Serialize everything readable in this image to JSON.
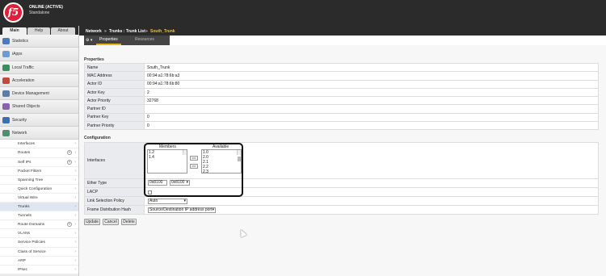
{
  "header": {
    "logo": "f5",
    "status_line1": "ONLINE (ACTIVE)",
    "status_line2": "Standalone"
  },
  "nav": {
    "tabs": [
      "Main",
      "Help",
      "About"
    ],
    "sections": [
      {
        "label": "Statistics",
        "icon": "chart-icon",
        "color": "#4a7bbf"
      },
      {
        "label": "iApps",
        "icon": "iapps-icon",
        "color": "#6a9bd3"
      },
      {
        "label": "Local Traffic",
        "icon": "traffic-icon",
        "color": "#3a8f5a"
      },
      {
        "label": "Acceleration",
        "icon": "acceleration-icon",
        "color": "#c24a3a"
      },
      {
        "label": "Device Management",
        "icon": "device-icon",
        "color": "#5b7da8"
      },
      {
        "label": "Shared Objects",
        "icon": "shared-objects-icon",
        "color": "#8a5fb0"
      },
      {
        "label": "Security",
        "icon": "security-icon",
        "color": "#3b6fb0"
      },
      {
        "label": "Network",
        "icon": "network-icon",
        "color": "#4f8f6f"
      }
    ],
    "network_items": [
      {
        "label": "Interfaces",
        "plus": false
      },
      {
        "label": "Routes",
        "plus": true
      },
      {
        "label": "Self IPs",
        "plus": true
      },
      {
        "label": "Packet Filters",
        "plus": false
      },
      {
        "label": "Spanning Tree",
        "plus": false
      },
      {
        "label": "Quick Configuration",
        "plus": false
      },
      {
        "label": "Virtual Wire",
        "plus": false
      },
      {
        "label": "Trunks",
        "plus": false
      },
      {
        "label": "Tunnels",
        "plus": false
      },
      {
        "label": "Route Domains",
        "plus": true
      },
      {
        "label": "VLANs",
        "plus": false
      },
      {
        "label": "Service Policies",
        "plus": false
      },
      {
        "label": "Class of Service",
        "plus": false
      },
      {
        "label": "ARP",
        "plus": false
      },
      {
        "label": "IPsec",
        "plus": false
      }
    ]
  },
  "breadcrumb": {
    "part1": "Network",
    "sep": "»",
    "part2": "Trunks : Trunk List",
    "part3": "South_Trunk"
  },
  "tabs": {
    "properties": "Properties",
    "resources": "Resources"
  },
  "properties": {
    "title": "Properties",
    "rows": [
      {
        "key": "Name",
        "value": "South_Trunk"
      },
      {
        "key": "MAC Address",
        "value": "00:94:a1:78:6b:a3"
      },
      {
        "key": "Actor ID",
        "value": "00:94:a1:78:6b:80"
      },
      {
        "key": "Actor Key",
        "value": "2"
      },
      {
        "key": "Actor Priority",
        "value": "32768"
      },
      {
        "key": "Partner ID",
        "value": ""
      },
      {
        "key": "Partner Key",
        "value": "0"
      },
      {
        "key": "Partner Priority",
        "value": "0"
      }
    ]
  },
  "configuration": {
    "title": "Configuration",
    "interfaces_label": "Interfaces",
    "members_label": "Members",
    "available_label": "Available",
    "members": [
      "1.2",
      "1.4"
    ],
    "available": [
      "1.0",
      "2.0",
      "2.1",
      "2.2",
      "2.3"
    ],
    "move_left": "<<",
    "move_right": ">>",
    "ether_type_label": "Ether Type",
    "ether_type_value": "0x8100",
    "ether_type_select": "0x8100",
    "lacp_label": "LACP",
    "link_selection_label": "Link Selection Policy",
    "link_selection_value": "Auto",
    "frame_hash_label": "Frame Distribution Hash",
    "frame_hash_value": "Source/Destination IP address port"
  },
  "actions": {
    "update": "Update",
    "cancel": "Cancel",
    "delete": "Delete"
  }
}
